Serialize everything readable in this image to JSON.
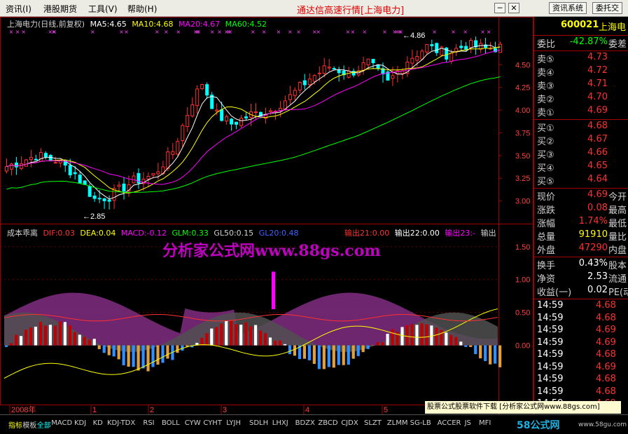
{
  "menu": [
    "资讯(I)",
    "港股期货",
    "工具(V)",
    "帮助(H)"
  ],
  "app_title": "通达信高速行情",
  "app_title_stock": "[上海电力]",
  "sys_buttons": [
    "资讯系统",
    "委托交"
  ],
  "win_buttons": {
    "min": "─",
    "close": "✕"
  },
  "main_legend": {
    "title": "上海电力(日线,前复权)",
    "ma5": "MA5:4.65",
    "ma10": "MA10:4.68",
    "ma20": "MA20:4.67",
    "ma60": "MA60:4.52"
  },
  "high_label": "4.86",
  "low_label": "2.85",
  "price_axis": [
    "4.50",
    "4.25",
    "4.00",
    "3.75",
    "3.50",
    "3.25",
    "3.00"
  ],
  "ind_legend": {
    "name": "成本乖离",
    "dif": "DIF:0.03",
    "dea": "DEA:0.04",
    "macd": "MACD:-0.12",
    "glm": "GLM:0.33",
    "gl50": "GL50:0.15",
    "gl20": "GL20:0.48",
    "out21": "输出21:0.00",
    "out22": "输出22:0.00",
    "out23": "输出23:-",
    "out_more": "输出"
  },
  "ind_axis": [
    "1.50",
    "1.00",
    "0.50",
    "0.00"
  ],
  "watermark": "分析家公式网www.88gs.com",
  "time_axis": [
    "2008年",
    "1",
    "2",
    "3",
    "4",
    "5"
  ],
  "quote": {
    "code": "600021",
    "name": "上海电",
    "weibi_label": "委比",
    "weibi": "-42.87%",
    "weicha_label": "委差",
    "asks": [
      {
        "label": "卖⑤",
        "price": "4.73"
      },
      {
        "label": "卖④",
        "price": "4.72"
      },
      {
        "label": "卖③",
        "price": "4.71"
      },
      {
        "label": "卖②",
        "price": "4.70"
      },
      {
        "label": "卖①",
        "price": "4.69"
      }
    ],
    "bids": [
      {
        "label": "买①",
        "price": "4.68"
      },
      {
        "label": "买②",
        "price": "4.67"
      },
      {
        "label": "买③",
        "price": "4.66"
      },
      {
        "label": "买④",
        "price": "4.65"
      },
      {
        "label": "买⑤",
        "price": "4.64"
      }
    ],
    "stats": [
      {
        "label": "现价",
        "value": "4.69",
        "extra": "今开",
        "color": "#ff3030"
      },
      {
        "label": "涨跌",
        "value": "0.08",
        "extra": "最高",
        "color": "#ff3030"
      },
      {
        "label": "涨幅",
        "value": "1.74%",
        "extra": "最低",
        "color": "#ff3030"
      },
      {
        "label": "总量",
        "value": "91910",
        "extra": "量比",
        "color": "#ffff00"
      },
      {
        "label": "外盘",
        "value": "47290",
        "extra": "内盘",
        "color": "#ff3030"
      }
    ],
    "stats2": [
      {
        "label": "换手",
        "value": "0.43%",
        "extra": "股本"
      },
      {
        "label": "净资",
        "value": "2.53",
        "extra": "流通"
      },
      {
        "label": "收益(一)",
        "value": "0.02",
        "extra": "PE(动"
      }
    ],
    "ticks": [
      {
        "time": "14:59",
        "price": "4.68"
      },
      {
        "time": "14:59",
        "price": "4.68"
      },
      {
        "time": "14:59",
        "price": "4.69"
      },
      {
        "time": "14:59",
        "price": "4.69"
      },
      {
        "time": "14:59",
        "price": "4.68"
      },
      {
        "time": "14:59",
        "price": "4.69"
      },
      {
        "time": "14:59",
        "price": "4.68"
      },
      {
        "time": "14:59",
        "price": "4.68"
      },
      {
        "time": "14:59",
        "price": "4.69"
      }
    ]
  },
  "ad_text": "股票公式股票软件下载 [分析家公式网www.88gs.com]",
  "tabs": [
    "指标",
    "模板",
    "全部",
    "MACD",
    "KDJ",
    "KD",
    "KDJ-TDX",
    "RSI",
    "BOLL",
    "CYW",
    "CYHT",
    "LYJH",
    "SDLH",
    "LHXJ",
    "BDZX",
    "ZBCD",
    "CJDX",
    "SLZT",
    "ZLMM",
    "SG-LB",
    "ACCER",
    "JS",
    "MFI"
  ],
  "logo": "58公式网",
  "logo_url": "www.58gu.com",
  "colors": {
    "up": "#ff3030",
    "down": "#00ffff",
    "ma5": "#ffffff",
    "ma10": "#ffff00",
    "ma20": "#ff00ff",
    "ma60": "#00ff00",
    "frame": "#a00000"
  }
}
